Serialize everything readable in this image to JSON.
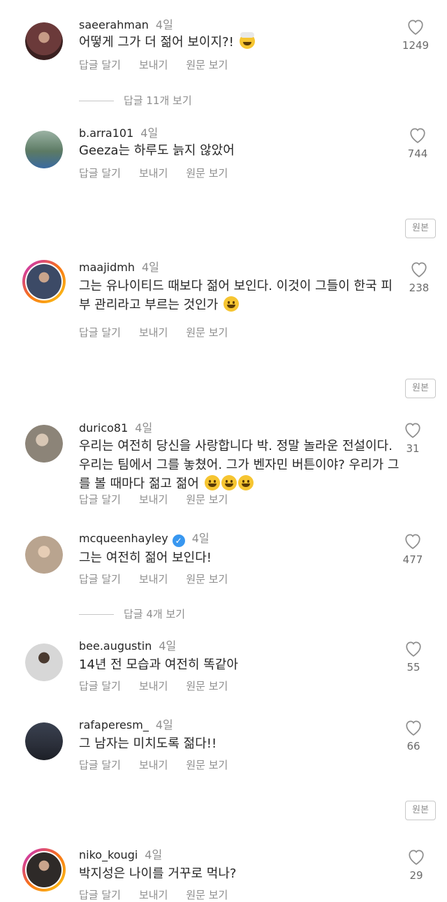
{
  "actions": {
    "reply": "답글 달기",
    "send": "보내기",
    "original": "원문 보기"
  },
  "badge_label": "원본",
  "comments": [
    {
      "username": "saeerahman",
      "time": "4일",
      "text": "어떻게 그가 더 젊어 보이지?!",
      "likes": "1249",
      "avatar_color": "#6b3a3a"
    },
    {
      "username": "b.arra101",
      "time": "4일",
      "text": "Geeza는 하루도 늙지 않았어",
      "likes": "744",
      "avatar_color": "#5c7a64"
    },
    {
      "username": "maajidmh",
      "time": "4일",
      "text": "그는 유나이티드 때보다 젊어 보인다. 이것이 그들이 한국 피부 관리라고 부르는 것인가",
      "likes": "238",
      "avatar_color": "#3c4a66"
    },
    {
      "username": "durico81",
      "time": "4일",
      "text": "우리는 여전히 당신을 사랑합니다 박. 정말 놀라운 전설이다. 우리는 팀에서 그를 놓쳤어. 그가 벤자민 버튼이야? 우리가 그를 볼 때마다 젊고 젊어",
      "likes": "31",
      "avatar_color": "#8c8478"
    },
    {
      "username": "mcqueenhayley",
      "time": "4일",
      "text": "그는 여전히 젊어 보인다!",
      "likes": "477",
      "avatar_color": "#b9a48f"
    },
    {
      "username": "bee.augustin",
      "time": "4일",
      "text": "14년 전 모습과 여전히 똑같아",
      "likes": "55",
      "avatar_color": "#6f6f74"
    },
    {
      "username": "rafaperesm_",
      "time": "4일",
      "text": "그 남자는 미치도록 젊다!!",
      "likes": "66",
      "avatar_color": "#2b2f3a"
    },
    {
      "username": "niko_kougi",
      "time": "4일",
      "text": "박지성은 나이를 거꾸로 먹나?",
      "likes": "29",
      "avatar_color": "#2e2a28"
    }
  ],
  "reply_threads": [
    "답글 11개 보기",
    "답글 4개 보기"
  ],
  "colors": {
    "text": "#262626",
    "muted": "#8e8e8e",
    "verified": "#3897f0"
  }
}
